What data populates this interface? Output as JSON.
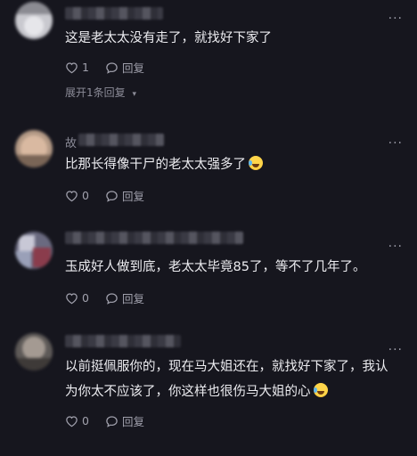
{
  "comments": [
    {
      "name_prefix": "",
      "text_lines": [
        "这是老太太没有走了，就找好下家了"
      ],
      "emoji": false,
      "like_count": "1",
      "reply_label": "回复",
      "expand_label": "展开1条回复"
    },
    {
      "name_prefix": "故",
      "text_lines": [
        "比那长得像干尸的老太太强多了"
      ],
      "emoji": true,
      "like_count": "0",
      "reply_label": "回复"
    },
    {
      "name_prefix": "",
      "text_lines": [
        "玉成好人做到底，老太太毕竟85了，等不了几年了。"
      ],
      "emoji": false,
      "like_count": "0",
      "reply_label": "回复"
    },
    {
      "name_prefix": "",
      "text_lines": [
        "以前挺佩服你的，现在马大姐还在，就找好下家了，我认",
        "为你太不应该了，你这样也很伤马大姐的心"
      ],
      "emoji": true,
      "like_count": "0",
      "reply_label": "回复"
    }
  ],
  "icons": {
    "like": "heart-icon",
    "reply": "comment-bubble-icon",
    "more": "more-dots-icon",
    "expand": "chevron-down-icon",
    "emoji": "laughing-emoji"
  },
  "colors": {
    "background": "#16161e",
    "text": "#ececf0",
    "muted": "#a0a0ac"
  }
}
